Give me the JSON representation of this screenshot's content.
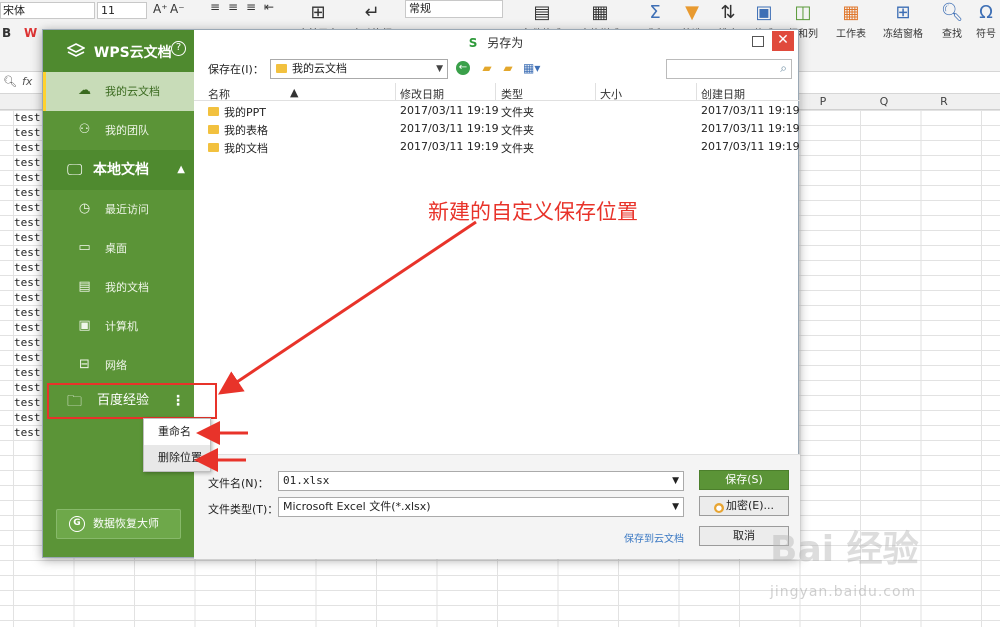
{
  "spreadsheet": {
    "font_name": "宋体",
    "font_size": "11",
    "number_format": "常规",
    "ribbon": [
      "求和",
      "筛选",
      "排序",
      "格式",
      "行和列",
      "工作表",
      "冻结窗格",
      "查找",
      "符号"
    ],
    "ribbon_partial": [
      "合并居中",
      "自动换行",
      "条件格式",
      "表格样式"
    ],
    "fx_label": "fx",
    "columns": [
      "P",
      "Q",
      "R"
    ],
    "cell_text": "test",
    "cell_rows": 22
  },
  "dialog": {
    "title": "另存为",
    "save_in_label": "保存在(I)：",
    "save_in_value": "我的云文档",
    "list_headers": {
      "name": "名称",
      "modified": "修改日期",
      "type": "类型",
      "size": "大小",
      "created": "创建日期"
    },
    "files": [
      {
        "name": "我的PPT",
        "modified": "2017/03/11 19:19",
        "type": "文件夹",
        "created": "2017/03/11 19:19"
      },
      {
        "name": "我的表格",
        "modified": "2017/03/11 19:19",
        "type": "文件夹",
        "created": "2017/03/11 19:19"
      },
      {
        "name": "我的文档",
        "modified": "2017/03/11 19:19",
        "type": "文件夹",
        "created": "2017/03/11 19:19"
      }
    ],
    "filename_label": "文件名(N)：",
    "filename_value": "01.xlsx",
    "filetype_label": "文件类型(T)：",
    "filetype_value": "Microsoft Excel 文件(*.xlsx)",
    "save_button": "保存(S)",
    "encrypt_button": "加密(E)...",
    "cancel_button": "取消",
    "cloud_link": "保存到云文档"
  },
  "sidebar": {
    "header": "WPS云文档",
    "cloud_items": [
      {
        "label": "我的云文档",
        "icon": "cloud-folder-icon",
        "active": true
      },
      {
        "label": "我的团队",
        "icon": "team-icon"
      }
    ],
    "local_section": "本地文档",
    "local_items": [
      {
        "label": "最近访问",
        "icon": "recent-icon"
      },
      {
        "label": "桌面",
        "icon": "desktop-icon"
      },
      {
        "label": "我的文档",
        "icon": "documents-icon"
      },
      {
        "label": "计算机",
        "icon": "computer-icon"
      },
      {
        "label": "网络",
        "icon": "network-icon"
      }
    ],
    "custom_location": "百度经验",
    "recover_button": "数据恢复大师"
  },
  "context_menu": {
    "rename": "重命名",
    "delete": "删除位置"
  },
  "annotation": "新建的自定义保存位置",
  "colors": {
    "sidebar_green": "#5b9437",
    "annotation_red": "#e8332a",
    "folder_yellow": "#f2c13f"
  },
  "watermark": {
    "brand": "Bai 经验",
    "url": "jingyan.baidu.com"
  }
}
